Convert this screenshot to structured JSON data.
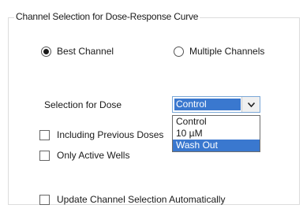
{
  "group": {
    "title": "Channel Selection for Dose-Response Curve"
  },
  "mode": {
    "best_channel_label": "Best Channel",
    "best_channel_selected": true,
    "multiple_channels_label": "Multiple Channels",
    "multiple_channels_selected": false
  },
  "dose": {
    "label": "Selection for Dose",
    "selected_value": "Control",
    "options": [
      "Control",
      "10 µM",
      "Wash Out"
    ],
    "highlighted_option": "Wash Out"
  },
  "options": {
    "including_previous_doses_label": "Including Previous Doses",
    "only_active_wells_label": "Only Active Wells",
    "update_automatically_label": "Update Channel Selection Automatically"
  },
  "icons": {
    "combo_arrow": "chevron-down-icon"
  },
  "colors": {
    "selection": "#3a78cf"
  }
}
